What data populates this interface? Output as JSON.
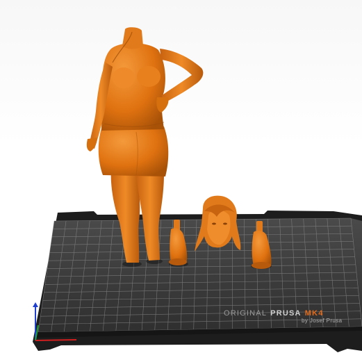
{
  "viewer": {
    "bed": {
      "brand_prefix": "ORIGINAL",
      "brand_name": "PRUSA",
      "brand_model": "MK4",
      "maker": "by Josef Prusa"
    },
    "colors": {
      "model": "#e87a16",
      "model_shadow": "#9a4a08",
      "bed_surface": "#3a3a3a",
      "bed_frame": "#1e1e1e",
      "grid": "#8c8c8c",
      "brand_accent": "#e36a1a",
      "axis_x": "#d11f1f",
      "axis_y": "#1fa33a",
      "axis_z": "#1f3fd1"
    },
    "objects": [
      "figure-body",
      "figure-head",
      "boot-left",
      "boot-right"
    ]
  }
}
